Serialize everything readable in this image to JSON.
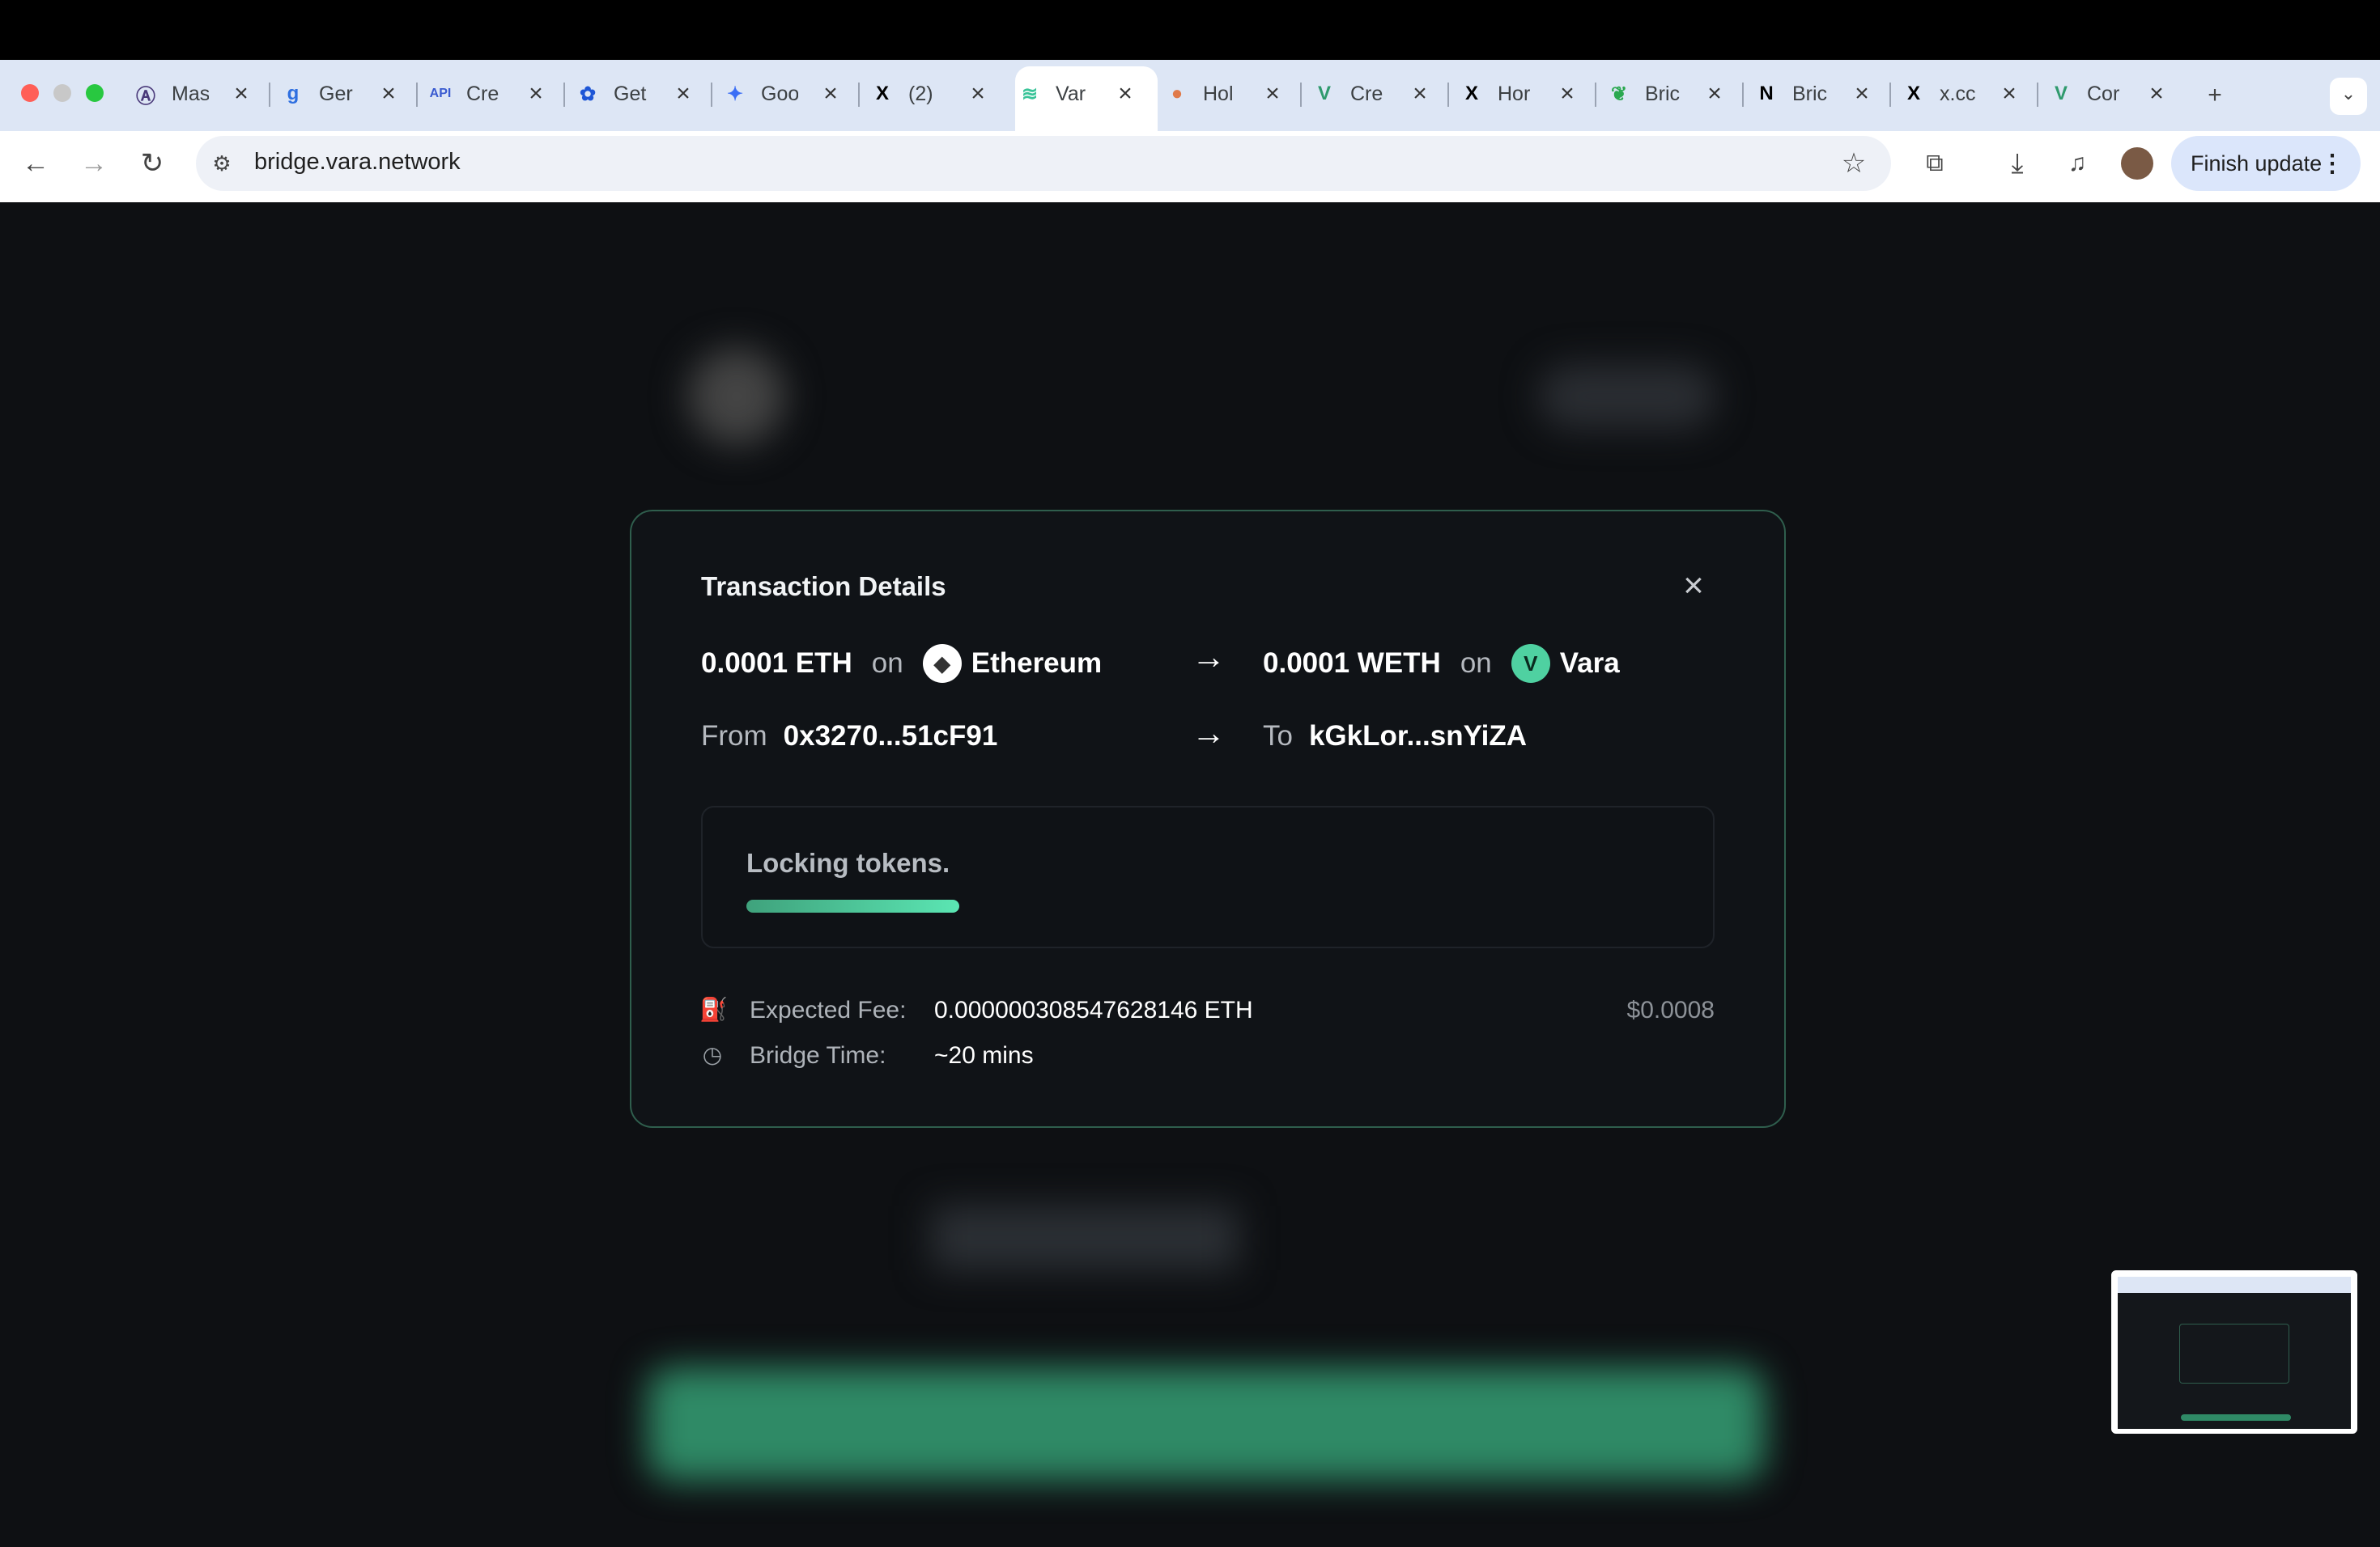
{
  "browser": {
    "tabs": [
      {
        "title": "Mas",
        "icon": "maskrider-logo-icon"
      },
      {
        "title": "Ger",
        "icon": "g-logo-icon"
      },
      {
        "title": "Cre",
        "icon": "api-icon"
      },
      {
        "title": "Get",
        "icon": "butterfly-icon"
      },
      {
        "title": "Goo",
        "icon": "gemini-sparkle-icon"
      },
      {
        "title": "(2)",
        "icon": "x-logo-icon"
      },
      {
        "title": "Var",
        "icon": "vara-logo-icon",
        "active": true
      },
      {
        "title": "Hol",
        "icon": "drop-icon"
      },
      {
        "title": "Cre",
        "icon": "vara-v-icon"
      },
      {
        "title": "Hor",
        "icon": "x-logo-icon"
      },
      {
        "title": "Bric",
        "icon": "leaf-icon"
      },
      {
        "title": "Bric",
        "icon": "notion-icon"
      },
      {
        "title": "x.cc",
        "icon": "x-logo-icon"
      },
      {
        "title": "Cor",
        "icon": "vara-v-icon"
      }
    ],
    "url": "bridge.vara.network",
    "finish_update": "Finish update"
  },
  "modal": {
    "title": "Transaction Details",
    "from_amount": "0.0001 ETH",
    "on_label": "on",
    "from_network": "Ethereum",
    "to_amount": "0.0001 WETH",
    "to_network": "Vara",
    "from_label": "From",
    "from_address": "0x3270...51cF91",
    "to_label": "To",
    "to_address": "kGkLor...snYiZA",
    "status": "Locking tokens.",
    "progress": 0.23,
    "fee_label": "Expected Fee:",
    "fee_value": "0.000000308547628146 ETH",
    "fee_usd": "$0.0008",
    "time_label": "Bridge Time:",
    "time_value": "~20 mins"
  },
  "colors": {
    "accent": "#4fd1a1",
    "modal_border": "#2f5e4d",
    "page_bg": "#0e1013"
  }
}
